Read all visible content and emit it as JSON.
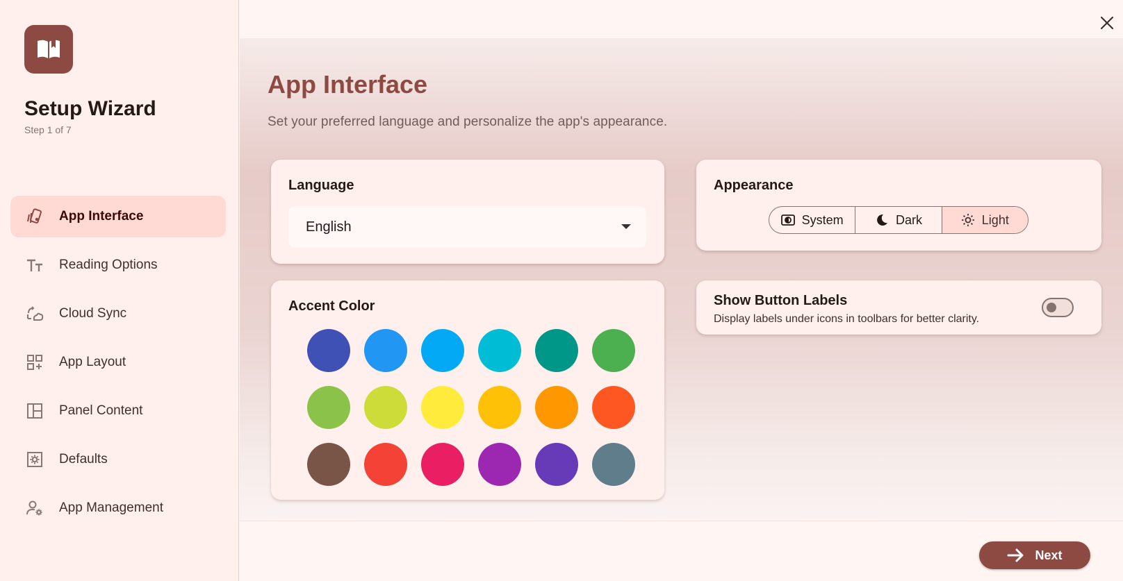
{
  "sidebar": {
    "title": "Setup Wizard",
    "step": "Step 1 of 7",
    "items": [
      {
        "label": "App Interface",
        "icon": "palette-card-icon",
        "active": true
      },
      {
        "label": "Reading Options",
        "icon": "text-size-icon"
      },
      {
        "label": "Cloud Sync",
        "icon": "cloud-sync-icon"
      },
      {
        "label": "App Layout",
        "icon": "grid-add-icon"
      },
      {
        "label": "Panel Content",
        "icon": "panel-layout-icon"
      },
      {
        "label": "Defaults",
        "icon": "settings-box-icon"
      },
      {
        "label": "App Management",
        "icon": "user-gear-icon"
      }
    ]
  },
  "main": {
    "title": "App Interface",
    "subtitle": "Set your preferred language and personalize the app's appearance.",
    "language": {
      "title": "Language",
      "value": "English"
    },
    "accent": {
      "title": "Accent Color",
      "colors": [
        "#3f51b5",
        "#2196f3",
        "#03a9f4",
        "#00bcd4",
        "#009688",
        "#4caf50",
        "#8bc34a",
        "#cddc39",
        "#ffeb3b",
        "#ffc107",
        "#ff9800",
        "#ff5722",
        "#795548",
        "#f44336",
        "#e91e63",
        "#9c27b0",
        "#673ab7",
        "#607d8b"
      ]
    },
    "appearance": {
      "title": "Appearance",
      "options": [
        {
          "label": "System",
          "icon": "system-mode-icon"
        },
        {
          "label": "Dark",
          "icon": "moon-icon"
        },
        {
          "label": "Light",
          "icon": "sun-icon",
          "selected": true
        }
      ]
    },
    "button_labels": {
      "title": "Show Button Labels",
      "description": "Display labels under icons in toolbars for better clarity.",
      "enabled": false
    }
  },
  "footer": {
    "next_label": "Next"
  },
  "theme": {
    "primary": "#8d4a43",
    "selected_bg": "#ffdad5",
    "surface": "#fff0ed"
  }
}
